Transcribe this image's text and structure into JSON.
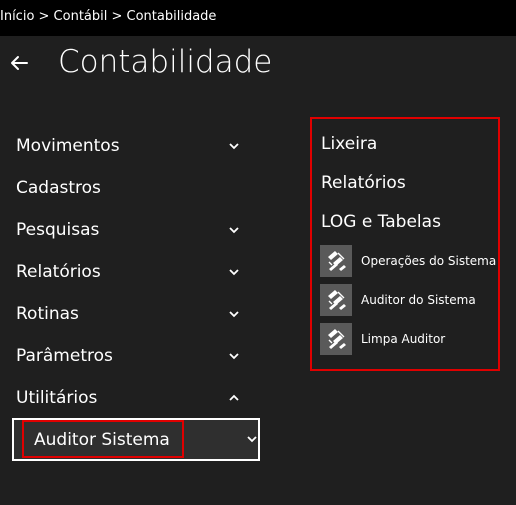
{
  "breadcrumb": {
    "text": "Início > Contábil > Contabilidade"
  },
  "header": {
    "title": "Contabilidade"
  },
  "menu": {
    "items": [
      {
        "label": "Movimentos",
        "chevron": "down"
      },
      {
        "label": "Cadastros",
        "chevron": "none"
      },
      {
        "label": "Pesquisas",
        "chevron": "down"
      },
      {
        "label": "Relatórios",
        "chevron": "down"
      },
      {
        "label": "Rotinas",
        "chevron": "down"
      },
      {
        "label": "Parâmetros",
        "chevron": "down"
      },
      {
        "label": "Utilitários",
        "chevron": "up"
      }
    ],
    "dropdown": {
      "label": "Auditor Sistema"
    }
  },
  "panel": {
    "headings": [
      "Lixeira",
      "Relatórios",
      "LOG e Tabelas"
    ],
    "links": [
      {
        "label": "Operações do Sistema",
        "icon": "shortcut-icon"
      },
      {
        "label": "Auditor do Sistema",
        "icon": "shortcut-icon"
      },
      {
        "label": "Limpa Auditor",
        "icon": "shortcut-icon"
      }
    ]
  },
  "colors": {
    "background": "#1f1f1f",
    "topbar": "#000000",
    "highlight": "#e00000",
    "icon_tile": "#5a5a5a"
  }
}
